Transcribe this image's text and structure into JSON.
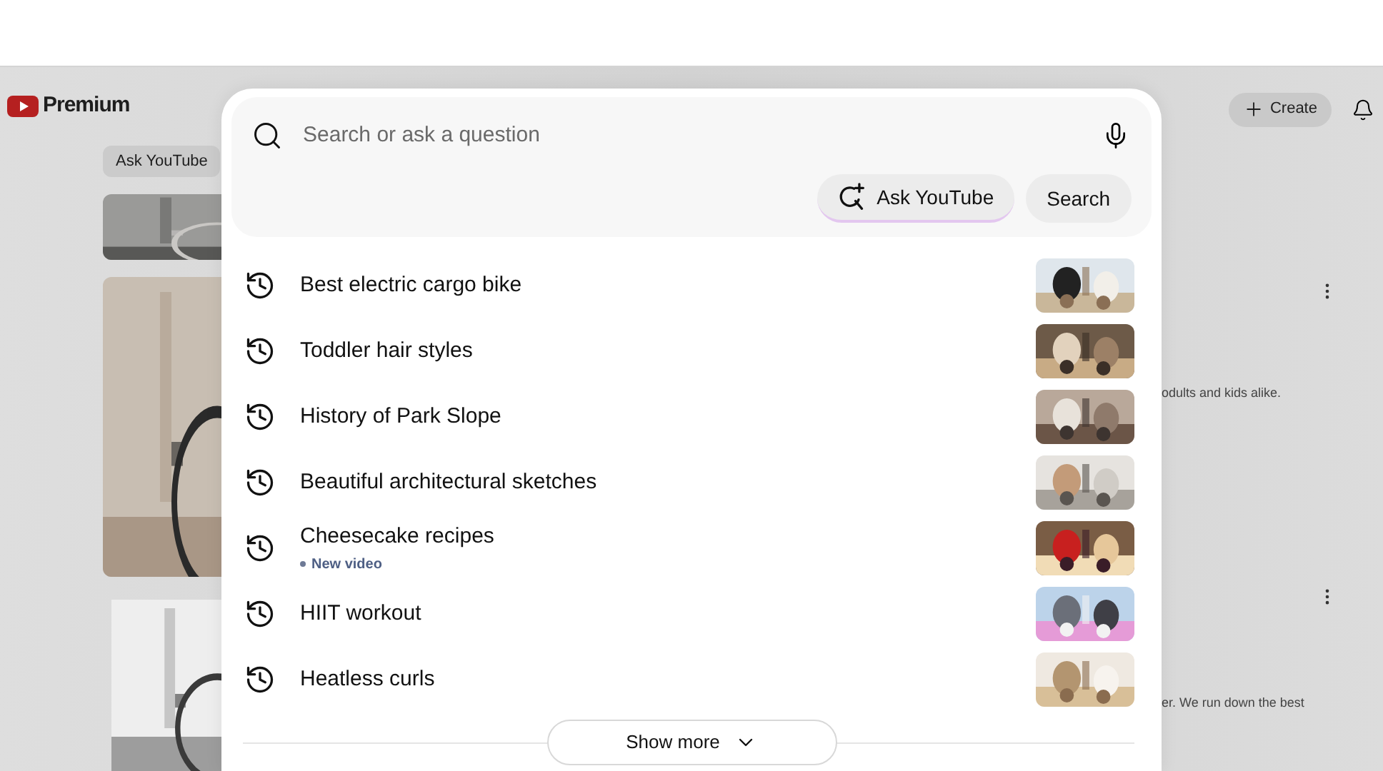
{
  "app": {
    "logo_text": "Premium",
    "create_button": "Create",
    "chip": "Ask YouTube"
  },
  "background_feed": [
    {
      "description": "odults and kids alike."
    },
    {
      "description": "er. We run down the best"
    }
  ],
  "search": {
    "placeholder": "Search or ask a question",
    "ask_button": "Ask YouTube",
    "search_button": "Search"
  },
  "history": [
    {
      "query": "Best electric cargo bike"
    },
    {
      "query": "Toddler hair styles"
    },
    {
      "query": "History of Park Slope"
    },
    {
      "query": "Beautiful architectural sketches"
    },
    {
      "query": "Cheesecake recipes",
      "badge": "New video"
    },
    {
      "query": "HIIT workout"
    },
    {
      "query": "Heatless curls"
    }
  ],
  "show_more": "Show more"
}
